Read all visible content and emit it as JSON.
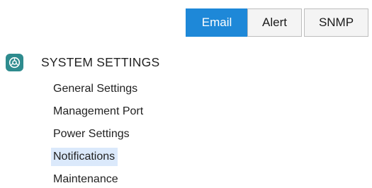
{
  "tabs": [
    {
      "label": "Email",
      "active": true
    },
    {
      "label": "Alert",
      "active": false
    },
    {
      "label": "SNMP",
      "active": false
    }
  ],
  "section": {
    "title": "SYSTEM SETTINGS",
    "icon": "settings-gauge-icon"
  },
  "menu": {
    "items": [
      {
        "label": "General Settings",
        "selected": false
      },
      {
        "label": "Management Port",
        "selected": false
      },
      {
        "label": "Power Settings",
        "selected": false
      },
      {
        "label": "Notifications",
        "selected": true
      },
      {
        "label": "Maintenance",
        "selected": false
      }
    ]
  },
  "colors": {
    "accent": "#1e88d8",
    "icon_bg": "#2e8b8e",
    "selected_bg": "#dbe9fb"
  }
}
